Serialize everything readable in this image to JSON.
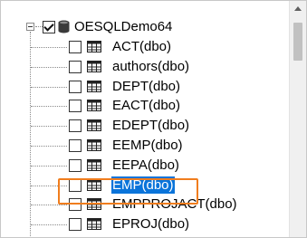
{
  "tree": {
    "database": {
      "label": "OESQLDemo64",
      "checked": true,
      "expanded": true
    },
    "tables": [
      {
        "label": "ACT(dbo)"
      },
      {
        "label": "authors(dbo)"
      },
      {
        "label": "DEPT(dbo)"
      },
      {
        "label": "EACT(dbo)"
      },
      {
        "label": "EDEPT(dbo)"
      },
      {
        "label": "EEMP(dbo)"
      },
      {
        "label": "EEPA(dbo)"
      },
      {
        "label": "EMP(dbo)",
        "selected": true
      },
      {
        "label": "EMPPROJACT(dbo)"
      },
      {
        "label": "EPROJ(dbo)"
      }
    ]
  },
  "colors": {
    "selection": "#0a74da",
    "highlight_box": "#f07d1e"
  },
  "icons": {
    "database": "database-icon",
    "table": "table-icon"
  }
}
